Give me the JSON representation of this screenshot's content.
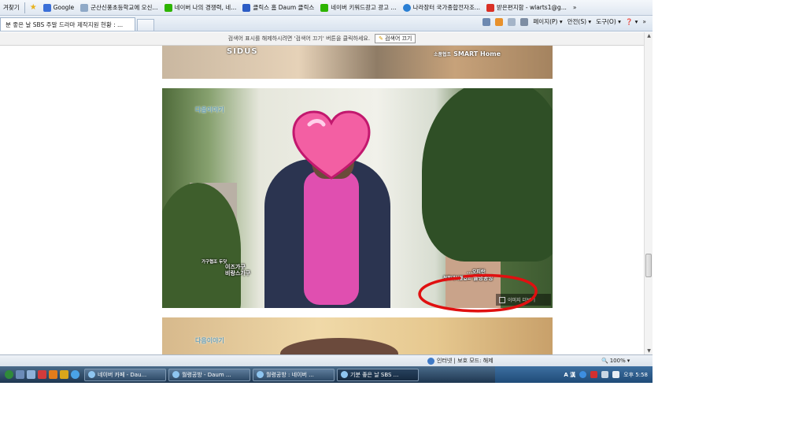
{
  "favorites": {
    "leading_text": "겨찾기",
    "items": [
      {
        "label": "Google",
        "color": "#3a6fd8"
      },
      {
        "label": "군산신풍초등학교에 오신...",
        "color": "#8fa9c7"
      },
      {
        "label": "네이버  나의 경쟁력, 네...",
        "color": "#2db400"
      },
      {
        "label": "클릭스 홈  Daum 클릭스",
        "color": "#2c5cc5"
      },
      {
        "label": "네이버 키워드광고  광고 ...",
        "color": "#2db400"
      },
      {
        "label": "나라장터 국가종합전자조...",
        "color": "#2a7fd4"
      },
      {
        "label": "받은편지함 - wlarts1@g...",
        "color": "#d93025"
      }
    ],
    "overflow": "»"
  },
  "tab": {
    "title": "분 좋은 날 SBS 주말 드라마 제작지원 현황 : ..."
  },
  "command_bar": {
    "page": "페이지(P) ▾",
    "safety": "안전(S) ▾",
    "tools": "도구(O) ▾",
    "help": "❓ ▾",
    "overflow": "»"
  },
  "info_bar": {
    "message": "검색어 표시를 해제하시려면 '검색어 끄기' 버튼을 클릭하세요.",
    "button": "검색어 끄기"
  },
  "content": {
    "image1": {
      "brand_left": "SIDUS",
      "brand_right_small": "소품협조",
      "brand_right": "SMART Home"
    },
    "image2": {
      "logo": "다음이야기",
      "caption_left_small": "가구협조 두닷",
      "caption_left_1": "이즈가구",
      "caption_left_2": "비랑스가구",
      "caption_right_top": "...오피란",
      "caption_right_small": "청목데이블협조",
      "caption_right": "월령공방",
      "image_button": "이미지 더보기"
    },
    "image3": {
      "logo": "다음이야기"
    }
  },
  "status_bar": {
    "zone": "인터넷 | 보호 모드: 해제",
    "zoom": "100%"
  },
  "taskbar": {
    "buttons": [
      {
        "label": "네이버 카페 - Dau..."
      },
      {
        "label": "월령공방 - Daum ..."
      },
      {
        "label": "월령공방 : 네이버 ..."
      },
      {
        "label": "기분 좋은 날 SBS ..."
      }
    ],
    "ime": "A 漢",
    "clock": "오후 5:58"
  },
  "colors": {
    "annotation_circle": "#e01010",
    "heart": "#f35fa3"
  }
}
